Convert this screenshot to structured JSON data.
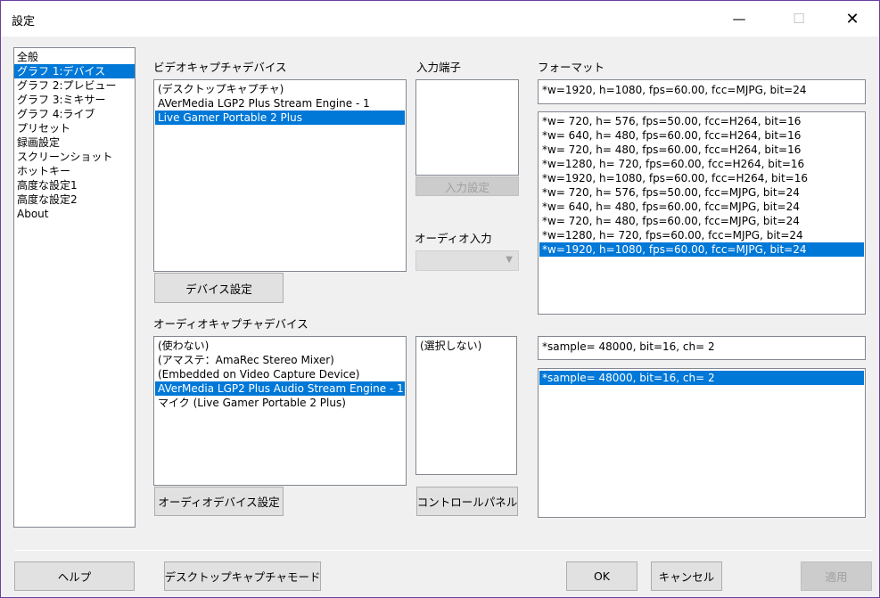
{
  "window": {
    "title": "設定"
  },
  "titlebar": {
    "min_icon": "—",
    "max_icon": "☐",
    "close_icon": "✕"
  },
  "sidebar": {
    "items": [
      {
        "label": "全般",
        "selected": false
      },
      {
        "label": "グラフ 1:デバイス",
        "selected": true
      },
      {
        "label": "グラフ 2:プレビュー",
        "selected": false
      },
      {
        "label": "グラフ 3:ミキサー",
        "selected": false
      },
      {
        "label": "グラフ 4:ライブ",
        "selected": false
      },
      {
        "label": "プリセット",
        "selected": false
      },
      {
        "label": "録画設定",
        "selected": false
      },
      {
        "label": "スクリーンショット",
        "selected": false
      },
      {
        "label": "ホットキー",
        "selected": false
      },
      {
        "label": "高度な設定1",
        "selected": false
      },
      {
        "label": "高度な設定2",
        "selected": false
      },
      {
        "label": "About",
        "selected": false
      }
    ]
  },
  "video_capture": {
    "label": "ビデオキャプチャデバイス",
    "devices": [
      {
        "label": "(デスクトップキャプチャ)",
        "selected": false
      },
      {
        "label": "AVerMedia LGP2 Plus Stream Engine - 1",
        "selected": false
      },
      {
        "label": "Live Gamer Portable 2 Plus",
        "selected": true
      }
    ],
    "settings_button": "デバイス設定"
  },
  "input_terminal": {
    "label": "入力端子",
    "settings_button": "入力設定"
  },
  "audio_input": {
    "label": "オーディオ入力",
    "value": ""
  },
  "format": {
    "label": "フォーマット",
    "current": "*w=1920, h=1080, fps=60.00,  fcc=MJPG, bit=24",
    "items": [
      {
        "label": "*w= 720, h= 576, fps=50.00,  fcc=H264, bit=16",
        "selected": false
      },
      {
        "label": "*w= 640, h= 480, fps=60.00,  fcc=H264, bit=16",
        "selected": false
      },
      {
        "label": "*w= 720, h= 480, fps=60.00,  fcc=H264, bit=16",
        "selected": false
      },
      {
        "label": "*w=1280, h= 720, fps=60.00,  fcc=H264, bit=16",
        "selected": false
      },
      {
        "label": "*w=1920, h=1080, fps=60.00,  fcc=H264, bit=16",
        "selected": false
      },
      {
        "label": "*w= 720, h= 576, fps=50.00,  fcc=MJPG, bit=24",
        "selected": false
      },
      {
        "label": "*w= 640, h= 480, fps=60.00,  fcc=MJPG, bit=24",
        "selected": false
      },
      {
        "label": "*w= 720, h= 480, fps=60.00,  fcc=MJPG, bit=24",
        "selected": false
      },
      {
        "label": "*w=1280, h= 720, fps=60.00,  fcc=MJPG, bit=24",
        "selected": false
      },
      {
        "label": "*w=1920, h=1080, fps=60.00,  fcc=MJPG, bit=24",
        "selected": true
      }
    ]
  },
  "audio_capture": {
    "label": "オーディオキャプチャデバイス",
    "devices": [
      {
        "label": "(使わない)",
        "selected": false
      },
      {
        "label": "(アマステ：AmaRec Stereo Mixer)",
        "selected": false
      },
      {
        "label": "(Embedded on Video Capture Device)",
        "selected": false
      },
      {
        "label": "AVerMedia LGP2 Plus Audio Stream Engine - 1",
        "selected": true
      },
      {
        "label": "マイク (Live Gamer Portable 2 Plus)",
        "selected": false
      }
    ],
    "settings_button": "オーディオデバイス設定"
  },
  "audio_terminal": {
    "items": [
      {
        "label": "(選択しない)",
        "selected": false
      }
    ],
    "control_panel_button": "コントロールパネル"
  },
  "audio_format": {
    "current": "*sample= 48000, bit=16, ch= 2",
    "items": [
      {
        "label": "*sample= 48000, bit=16, ch= 2",
        "selected": true
      }
    ]
  },
  "footer": {
    "help_button": "ヘルプ",
    "desktop_mode_button": "デスクトップキャプチャモード",
    "ok_button": "OK",
    "cancel_button": "キャンセル",
    "apply_button": "適用"
  },
  "colors": {
    "selection": "#0078d7",
    "dialog_bg": "#f0f0f0"
  }
}
